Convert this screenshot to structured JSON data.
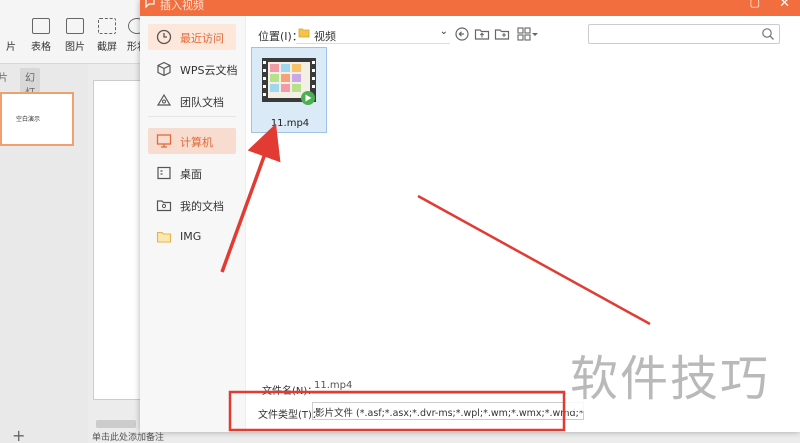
{
  "dialog": {
    "title": "插入视频",
    "close_glyph": "✕",
    "max_glyph": "▢"
  },
  "background_app": {
    "ribbon": {
      "buttons": [
        "片",
        "表格",
        "图片",
        "截屏",
        "形状"
      ]
    },
    "tabs": {
      "outline": "片",
      "slides": "幻灯片"
    },
    "slide_thumb_text": "空白演示",
    "notes_text": "单击此处添加备注",
    "add_slide_glyph": "+"
  },
  "sidebar": {
    "items": [
      {
        "label": "最近访问",
        "icon": "clock-icon",
        "state": "active"
      },
      {
        "label": "WPS云文档",
        "icon": "cube-icon",
        "state": "normal"
      },
      {
        "label": "团队文档",
        "icon": "team-icon",
        "state": "normal"
      },
      {
        "label": "计算机",
        "icon": "monitor-icon",
        "state": "hovered"
      },
      {
        "label": "桌面",
        "icon": "desktop-icon",
        "state": "normal"
      },
      {
        "label": "我的文档",
        "icon": "documents-icon",
        "state": "normal"
      },
      {
        "label": "IMG",
        "icon": "folder-icon",
        "state": "normal"
      }
    ]
  },
  "toolbar": {
    "location_label": "位置(I)：",
    "location_value": "视频",
    "chevron": "⌄",
    "search_placeholder": ""
  },
  "files": [
    {
      "name": "11.mp4",
      "icon": "video-file-icon",
      "selected": true
    }
  ],
  "bottom": {
    "filename_label": "文件名(N)：",
    "filename_value": "11.mp4",
    "filetype_label": "文件类型(T)：",
    "filetype_value": "影片文件 (*.asf;*.asx;*.dvr-ms;*.wpl;*.wm;*.wmx;*.wmd;*.wmz;*.a"
  },
  "watermark": "软件技巧",
  "colors": {
    "accent": "#f36e3e",
    "annotation_red": "#e23b33",
    "selection": "#dbeaf7"
  }
}
